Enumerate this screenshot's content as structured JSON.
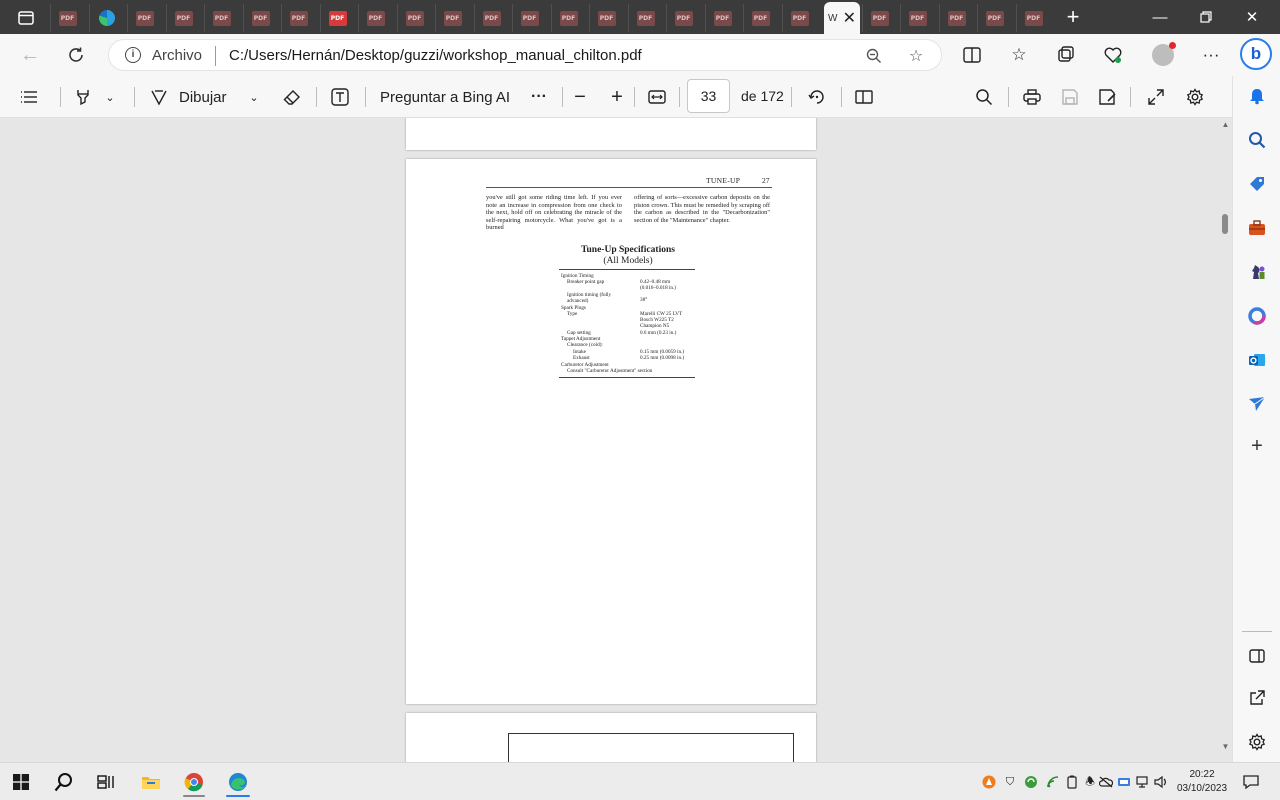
{
  "browser": {
    "active_tab_title": "W",
    "pdf_tab_badge": "PDF",
    "address_label": "Archivo",
    "url": "C:/Users/Hernán/Desktop/guzzi/workshop_manual_chilton.pdf"
  },
  "pdf_toolbar": {
    "draw_label": "Dibujar",
    "ask_bing_label": "Preguntar a Bing AI",
    "more_label": "···",
    "current_page": "33",
    "page_total": "de 172"
  },
  "document": {
    "header": "TUNE-UP",
    "page_number": "27",
    "col_left": "you've still got some riding time left. If you ever note an increase in compression from one check to the next, hold off on celebrating the miracle of the self-repairing motorcycle. What you've got is a burned",
    "col_right": "offering of sorts—excessive carbon deposits on the piston crown. This must be remedied by scraping off the carbon as described in the \"Decarbonization\" section of the \"Maintenance\" chapter.",
    "spec_title": "Tune-Up Specifications",
    "spec_subtitle": "(All Models)",
    "spec_rows": [
      {
        "left": "Ignition Timing",
        "right": ""
      },
      {
        "left": "Breaker point gap",
        "right": "0.42–0.48 mm"
      },
      {
        "left": "",
        "right": "(0.016–0.018 in.)"
      },
      {
        "left": "Ignition timing (fully",
        "right": "38°"
      },
      {
        "left": "advanced)",
        "right": ""
      },
      {
        "left": "Spark Plugs",
        "right": ""
      },
      {
        "left": "Type",
        "right": "Marelli CW 25 LVT"
      },
      {
        "left": "",
        "right": "Bosch W225 T2"
      },
      {
        "left": "",
        "right": "Champion N5"
      },
      {
        "left": "Gap setting",
        "right": "0.6 mm (0.23 in.)"
      },
      {
        "left": "Tappet Adjustment",
        "right": ""
      },
      {
        "left": "Clearance (cold):",
        "right": ""
      },
      {
        "left": "Intake",
        "right": "0.15 mm (0.0059 in.)"
      },
      {
        "left": "Exhaust",
        "right": "0.25 mm (0.0098 in.)"
      },
      {
        "left": "Carburetor Adjustment",
        "right": ""
      },
      {
        "left": "Consult \"Carburetor Adjustment\" section",
        "right": ""
      }
    ]
  },
  "taskbar": {
    "time": "20:22",
    "date": "03/10/2023"
  },
  "colors": {
    "tabbar": "#3b3b3b",
    "pdf_icon": "#b43c3c",
    "bing_accent": "#2b7de9"
  }
}
